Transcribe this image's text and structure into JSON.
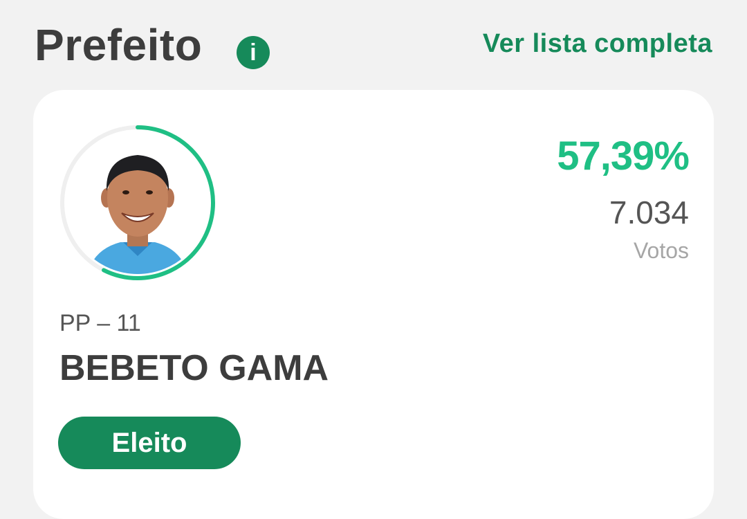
{
  "header": {
    "title": "Prefeito",
    "info_icon_glyph": "i",
    "see_all_label": "Ver lista completa"
  },
  "candidate": {
    "percentage": "57,39%",
    "percentage_value": 57.39,
    "votes": "7.034",
    "votes_label": "Votos",
    "party": "PP – 11",
    "name": "BEBETO GAMA",
    "status": "Eleito",
    "photo": "candidate-photo"
  },
  "colors": {
    "brand_green": "#168a5a",
    "accent_green": "#1fbf84",
    "text_dark": "#3d3d3d",
    "text_muted": "#a6a6a6",
    "background": "#f2f2f2",
    "card": "#ffffff"
  }
}
